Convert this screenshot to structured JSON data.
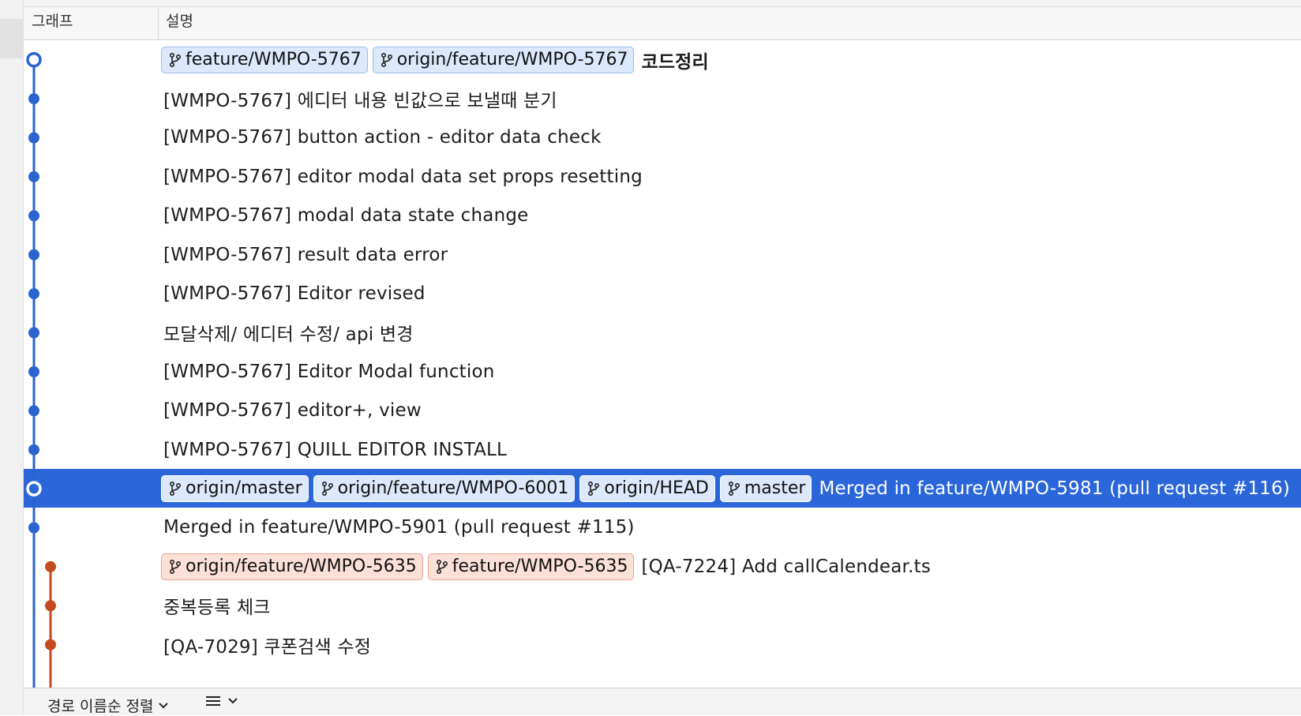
{
  "header": {
    "graph_label": "그래프",
    "description_label": "설명"
  },
  "colors": {
    "main_lane": "#2a64cf",
    "branch_lane": "#c44a1f",
    "selection": "#2b66d9"
  },
  "icons": {
    "branch": "branch-icon",
    "sort_chevron": "chevron-down-icon",
    "list": "list-icon"
  },
  "commits": [
    {
      "tags": [
        {
          "label": "feature/WMPO-5767",
          "color": "blue"
        },
        {
          "label": "origin/feature/WMPO-5767",
          "color": "blue"
        }
      ],
      "message": "코드정리",
      "bold": true,
      "lane": 0,
      "node": "hollow"
    },
    {
      "tags": [],
      "message": "[WMPO-5767] 에디터 내용 빈값으로 보낼때 분기",
      "lane": 0
    },
    {
      "tags": [],
      "message": "[WMPO-5767] button action - editor data check",
      "lane": 0
    },
    {
      "tags": [],
      "message": "[WMPO-5767] editor modal data set props resetting",
      "lane": 0
    },
    {
      "tags": [],
      "message": "[WMPO-5767] modal data state change",
      "lane": 0
    },
    {
      "tags": [],
      "message": "[WMPO-5767] result data error",
      "lane": 0
    },
    {
      "tags": [],
      "message": "[WMPO-5767] Editor revised",
      "lane": 0
    },
    {
      "tags": [],
      "message": "모달삭제/ 에디터 수정/ api 변경",
      "lane": 0
    },
    {
      "tags": [],
      "message": "[WMPO-5767] Editor Modal function",
      "lane": 0
    },
    {
      "tags": [],
      "message": "[WMPO-5767] editor+, view",
      "lane": 0
    },
    {
      "tags": [],
      "message": "[WMPO-5767] QUILL EDITOR INSTALL",
      "lane": 0
    },
    {
      "tags": [
        {
          "label": "origin/master",
          "color": "blue"
        },
        {
          "label": "origin/feature/WMPO-6001",
          "color": "blue"
        },
        {
          "label": "origin/HEAD",
          "color": "blue"
        },
        {
          "label": "master",
          "color": "blue"
        }
      ],
      "message": "Merged in feature/WMPO-5981 (pull request #116)",
      "lane": 0,
      "node": "hollow",
      "selected": true
    },
    {
      "tags": [],
      "message": "Merged in feature/WMPO-5901 (pull request #115)",
      "lane": 0
    },
    {
      "tags": [
        {
          "label": "origin/feature/WMPO-5635",
          "color": "red"
        },
        {
          "label": "feature/WMPO-5635",
          "color": "red"
        }
      ],
      "message": "[QA-7224] Add callCalendear.ts",
      "lane": 1
    },
    {
      "tags": [],
      "message": "중복등록 체크",
      "lane": 1
    },
    {
      "tags": [],
      "message": "[QA-7029] 쿠폰검색 수정",
      "lane": 1
    }
  ],
  "footer": {
    "sort_label": "경로 이름순 정렬"
  }
}
